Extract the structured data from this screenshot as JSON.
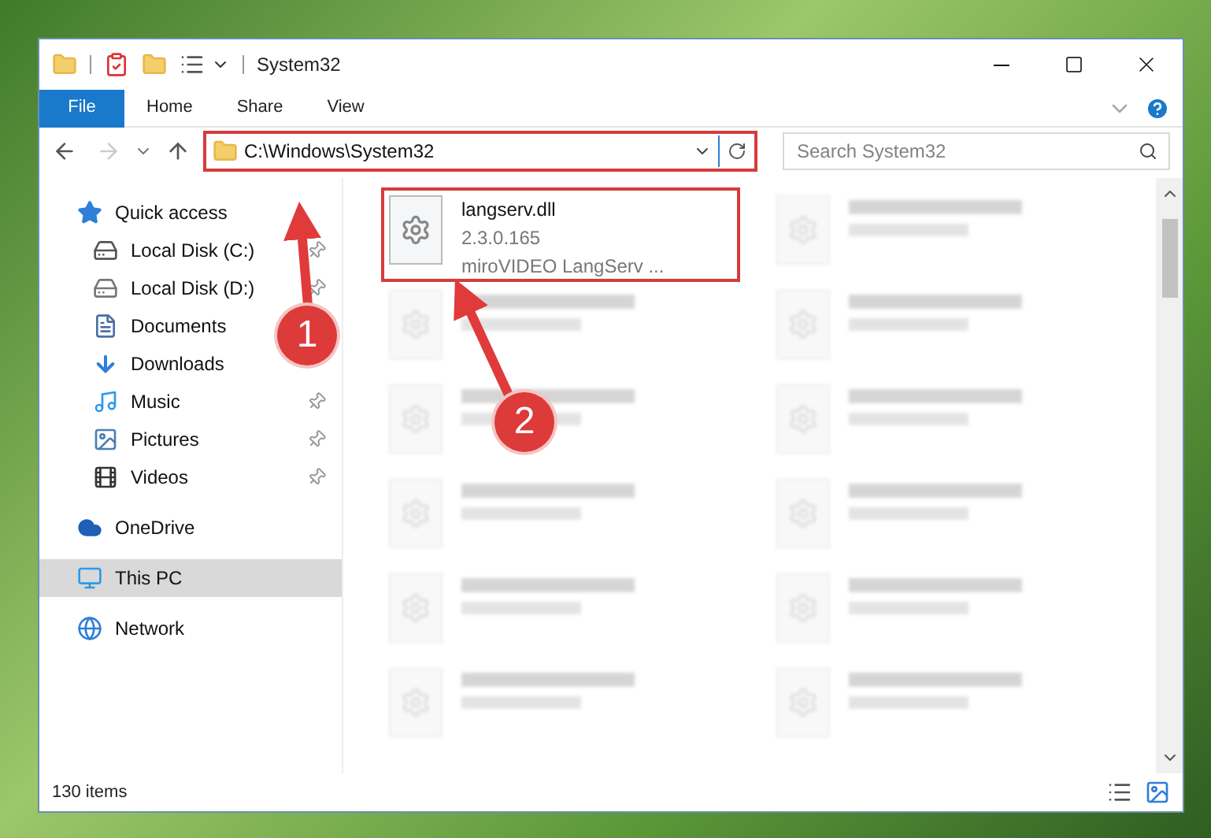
{
  "window": {
    "title": "System32"
  },
  "ribbon_tabs": [
    {
      "label": "File",
      "kind": "file"
    },
    {
      "label": "Home",
      "kind": "tab"
    },
    {
      "label": "Share",
      "kind": "tab"
    },
    {
      "label": "View",
      "kind": "tab"
    }
  ],
  "address_bar": {
    "path": "C:\\Windows\\System32"
  },
  "search": {
    "placeholder": "Search System32"
  },
  "sidebar": {
    "items": [
      {
        "label": "Quick access",
        "kind": "star",
        "selected": false,
        "children": [
          {
            "label": "Local Disk (C:)",
            "kind": "system-drive",
            "pinned": true,
            "selected": false
          },
          {
            "label": "Local Disk (D:)",
            "kind": "drive",
            "pinned": true,
            "selected": false
          },
          {
            "label": "Documents",
            "kind": "document",
            "pinned": false,
            "selected": false
          },
          {
            "label": "Downloads",
            "kind": "download",
            "pinned": false,
            "selected": false
          },
          {
            "label": "Music",
            "kind": "music",
            "pinned": true,
            "selected": false
          },
          {
            "label": "Pictures",
            "kind": "picture",
            "pinned": true,
            "selected": false
          },
          {
            "label": "Videos",
            "kind": "video",
            "pinned": true,
            "selected": false
          }
        ]
      },
      {
        "label": "OneDrive",
        "kind": "cloud",
        "selected": false
      },
      {
        "label": "This PC",
        "kind": "computer",
        "selected": true
      },
      {
        "label": "Network",
        "kind": "network",
        "selected": false
      }
    ]
  },
  "files": [
    {
      "kind": "file",
      "name": "langserv.dll",
      "lines": [
        "2.3.0.165",
        "miroVIDEO LangServ ..."
      ]
    },
    {
      "kind": "blurred"
    },
    {
      "kind": "blurred"
    },
    {
      "kind": "blurred"
    },
    {
      "kind": "blurred"
    },
    {
      "kind": "blurred"
    },
    {
      "kind": "blurred"
    },
    {
      "kind": "blurred"
    },
    {
      "kind": "blurred"
    },
    {
      "kind": "blurred"
    },
    {
      "kind": "blurred"
    },
    {
      "kind": "blurred"
    }
  ],
  "status_bar": {
    "item_count": "130 items"
  },
  "annotations": [
    {
      "label": "1"
    },
    {
      "label": "2"
    }
  ]
}
